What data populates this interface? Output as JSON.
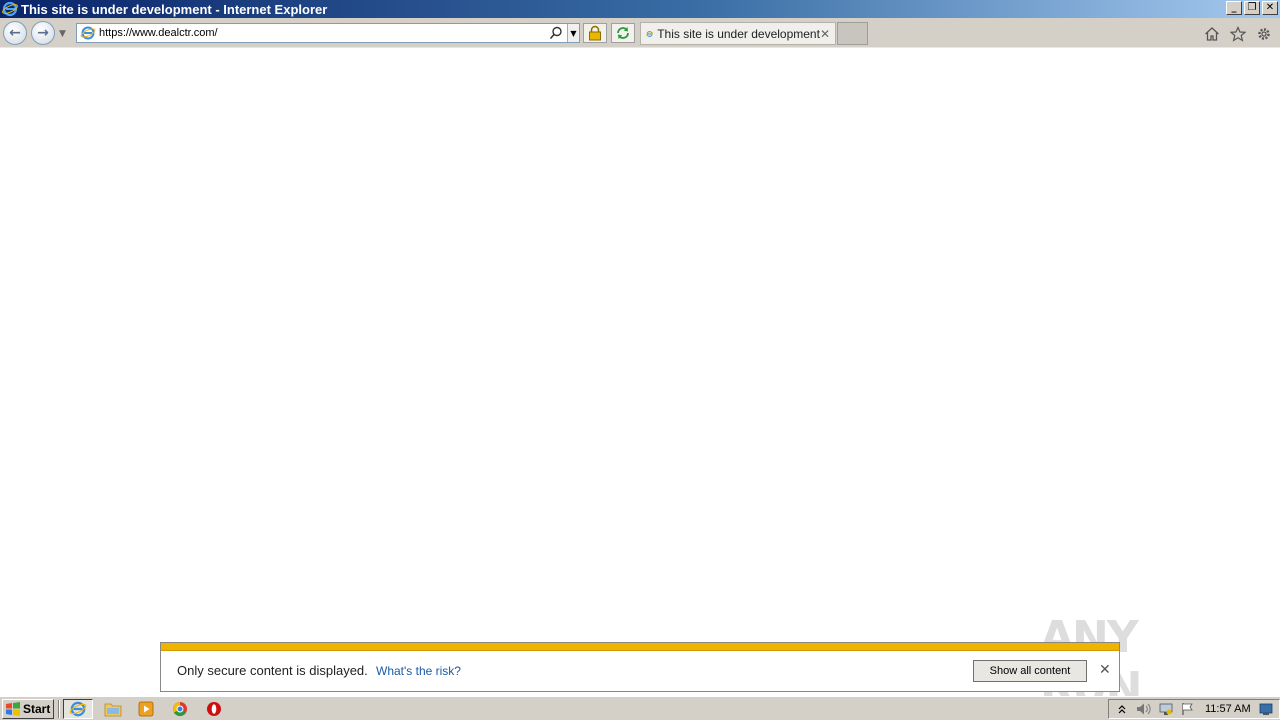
{
  "window": {
    "title": "This site is under development - Internet Explorer",
    "controls": [
      "minimize",
      "restore",
      "close"
    ]
  },
  "toolbar": {
    "url": "https://www.dealctr.com/",
    "tab_title": "This site is under development",
    "icons": [
      "back-icon",
      "forward-icon",
      "search-icon",
      "lock-icon",
      "refresh-icon",
      "home-icon",
      "favorites-star-icon",
      "gear-icon"
    ]
  },
  "notification": {
    "message": "Only secure content is displayed.",
    "risk_link": "What's the risk?",
    "show_button": "Show all content",
    "accent_color": "#f0b400"
  },
  "watermark": {
    "text": "ANY RUN"
  },
  "taskbar": {
    "start_label": "Start",
    "apps": [
      "internet-explorer",
      "file-explorer",
      "media-player",
      "chrome",
      "opera"
    ],
    "clock": "11:57 AM"
  }
}
